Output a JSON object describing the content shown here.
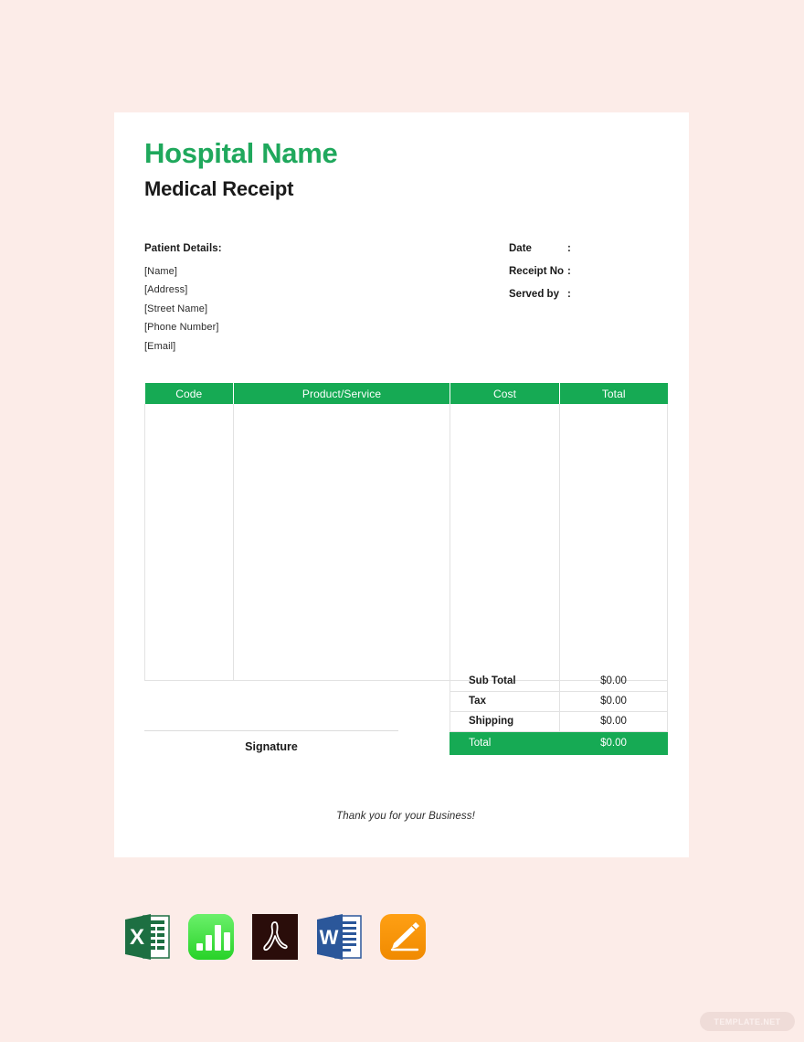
{
  "document": {
    "hospital_name": "Hospital Name",
    "title": "Medical Receipt",
    "background_color": "#fcece8",
    "accent_color": "#16AA54",
    "title_color": "#1FA85C"
  },
  "patient": {
    "heading": "Patient Details:",
    "lines": [
      "[Name]",
      "[Address]",
      "[Street Name]",
      "[Phone Number]",
      "[Email]"
    ]
  },
  "meta": {
    "rows": [
      {
        "label": "Date",
        "colon": ":",
        "value": ""
      },
      {
        "label": "Receipt No",
        "colon": ":",
        "value": ""
      },
      {
        "label": "Served by",
        "colon": ":",
        "value": ""
      }
    ]
  },
  "items_table": {
    "headers": [
      "Code",
      "Product/Service",
      "Cost",
      "Total"
    ],
    "rows": []
  },
  "summary": {
    "rows": [
      {
        "label": "Sub Total",
        "value": "$0.00"
      },
      {
        "label": "Tax",
        "value": "$0.00"
      },
      {
        "label": "Shipping",
        "value": "$0.00"
      }
    ],
    "grand_total": {
      "label": "Total",
      "value": "$0.00"
    }
  },
  "signature": {
    "label": "Signature"
  },
  "footer": {
    "thanks": "Thank you for your Business!"
  },
  "formats": [
    {
      "name": "excel-icon",
      "label": "Excel"
    },
    {
      "name": "numbers-icon",
      "label": "Numbers"
    },
    {
      "name": "pdf-icon",
      "label": "PDF"
    },
    {
      "name": "word-icon",
      "label": "Word"
    },
    {
      "name": "pages-icon",
      "label": "Pages"
    }
  ],
  "watermark": {
    "text": "TEMPLATE.NET"
  }
}
